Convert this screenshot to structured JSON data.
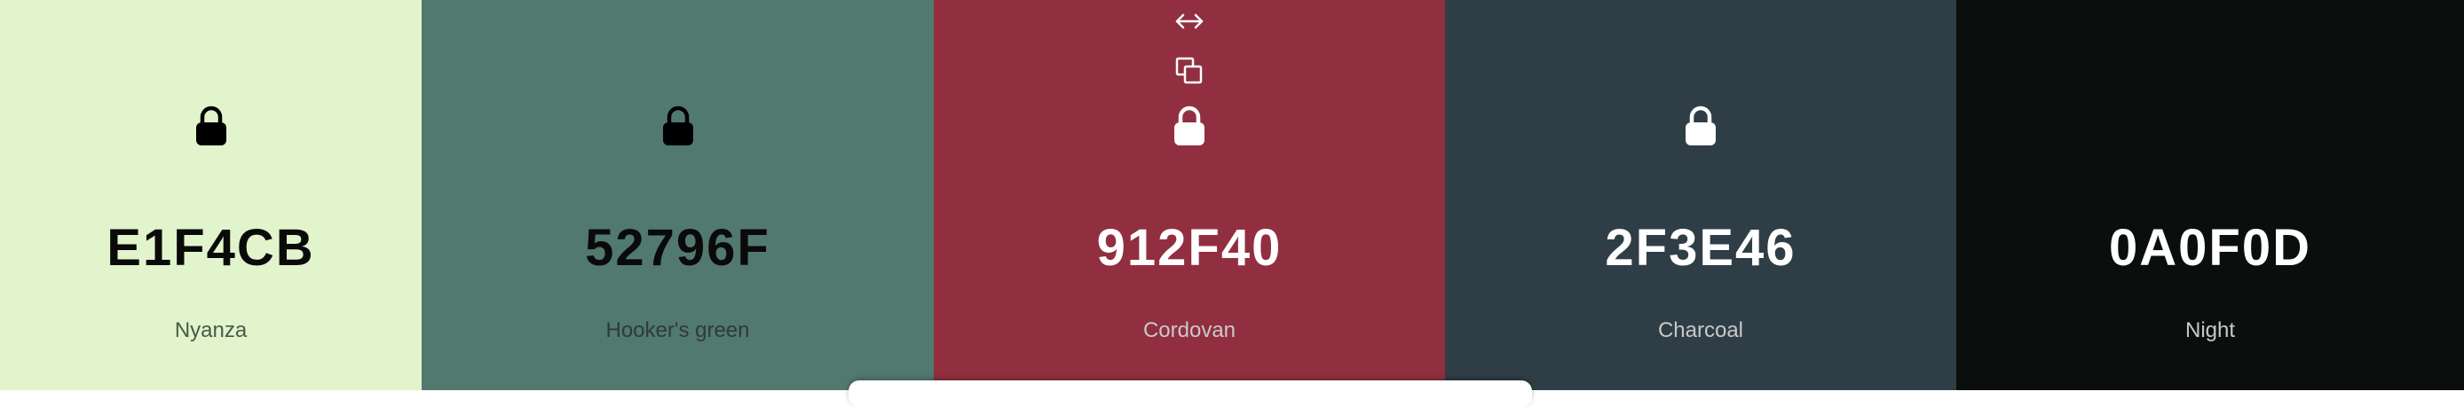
{
  "swatches": [
    {
      "hex": "E1F4CB",
      "name": "Nyanza",
      "color": "#E1F4CB"
    },
    {
      "hex": "52796F",
      "name": "Hooker's green",
      "color": "#52796F"
    },
    {
      "hex": "912F40",
      "name": "Cordovan",
      "color": "#912F40"
    },
    {
      "hex": "2F3E46",
      "name": "Charcoal",
      "color": "#2F3E46"
    },
    {
      "hex": "0A0F0D",
      "name": "Night",
      "color": "#0A0F0D"
    }
  ],
  "icons": {
    "lock": "lock-icon",
    "drag": "drag-horizontal-icon",
    "copy": "copy-icon"
  }
}
